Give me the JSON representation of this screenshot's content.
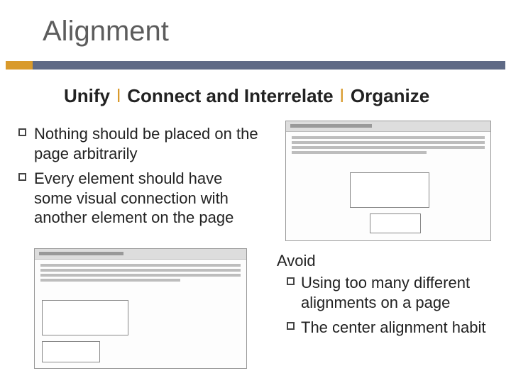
{
  "title": "Alignment",
  "subtitle": {
    "part1": "Unify",
    "part2": "Connect and Interrelate",
    "part3": "Organize",
    "separator": "l"
  },
  "bullets_left": [
    "Nothing should be placed on the page arbitrarily",
    "Every element should have some visual connection with another element on the page"
  ],
  "avoid": {
    "heading": "Avoid",
    "items": [
      "Using too many different alignments on a page",
      "The center alignment habit"
    ]
  }
}
